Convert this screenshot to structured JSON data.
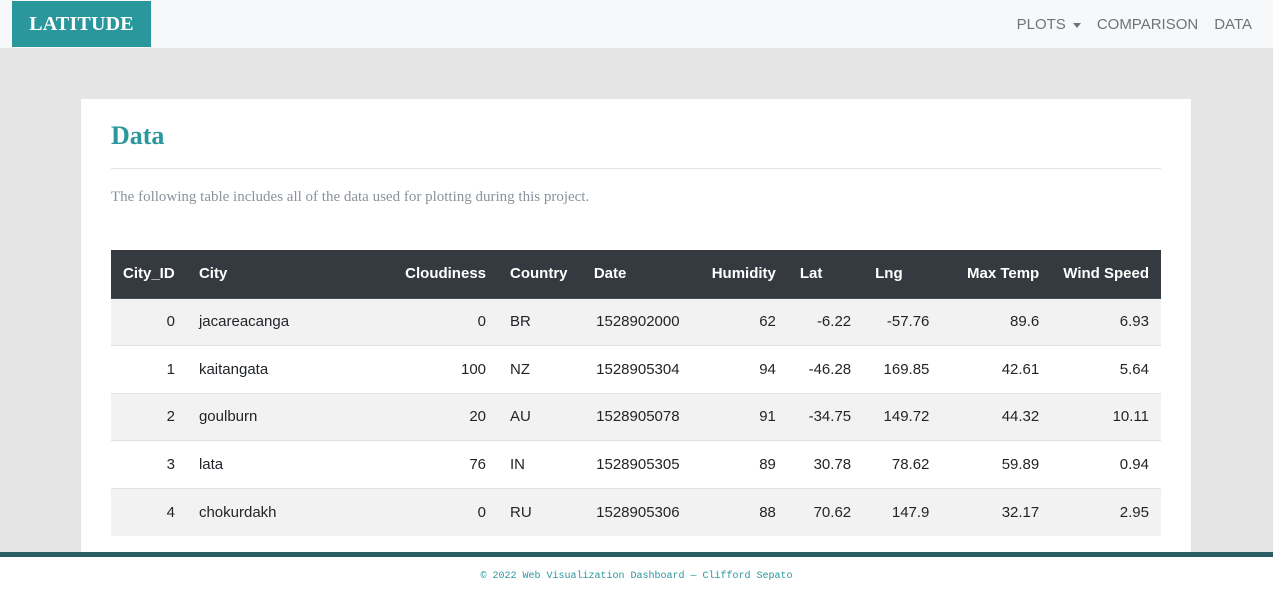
{
  "navbar": {
    "brand": "LATITUDE",
    "links": [
      {
        "label": "PLOTS"
      },
      {
        "label": "COMPARISON"
      },
      {
        "label": "DATA"
      }
    ]
  },
  "page": {
    "title": "Data",
    "intro": "The following table includes all of the data used for plotting during this project."
  },
  "table": {
    "columns": [
      "City_ID",
      "City",
      "Cloudiness",
      "Country",
      "Date",
      "Humidity",
      "Lat",
      "Lng",
      "Max Temp",
      "Wind Speed"
    ],
    "rows": [
      [
        "0",
        "jacareacanga",
        "0",
        "BR",
        "1528902000",
        "62",
        "-6.22",
        "-57.76",
        "89.6",
        "6.93"
      ],
      [
        "1",
        "kaitangata",
        "100",
        "NZ",
        "1528905304",
        "94",
        "-46.28",
        "169.85",
        "42.61",
        "5.64"
      ],
      [
        "2",
        "goulburn",
        "20",
        "AU",
        "1528905078",
        "91",
        "-34.75",
        "149.72",
        "44.32",
        "10.11"
      ],
      [
        "3",
        "lata",
        "76",
        "IN",
        "1528905305",
        "89",
        "30.78",
        "78.62",
        "59.89",
        "0.94"
      ],
      [
        "4",
        "chokurdakh",
        "0",
        "RU",
        "1528905306",
        "88",
        "70.62",
        "147.9",
        "32.17",
        "2.95"
      ]
    ]
  },
  "footer": {
    "text": "© 2022 Web Visualization Dashboard — Clifford Sepato"
  }
}
